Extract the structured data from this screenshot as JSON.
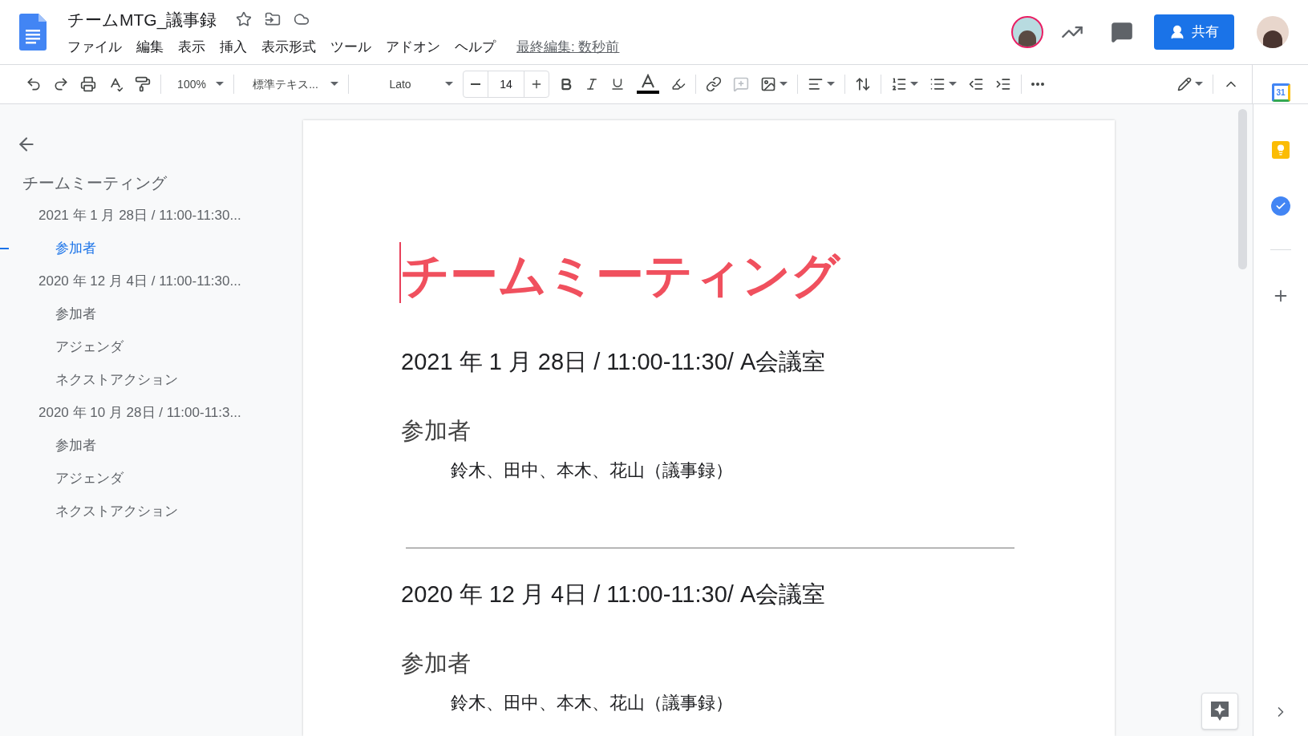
{
  "document": {
    "title": "チームMTG_議事録",
    "last_edit": "最終編集: 数秒前"
  },
  "menus": [
    {
      "label": "ファイル"
    },
    {
      "label": "編集"
    },
    {
      "label": "表示"
    },
    {
      "label": "挿入"
    },
    {
      "label": "表示形式"
    },
    {
      "label": "ツール"
    },
    {
      "label": "アドオン"
    },
    {
      "label": "ヘルプ"
    }
  ],
  "share_button": {
    "label": "共有"
  },
  "toolbar": {
    "zoom": "100%",
    "style": "標準テキス...",
    "font": "Lato",
    "font_size": "14"
  },
  "outline": [
    {
      "label": "チームミーティング",
      "selected": false,
      "children": [
        {
          "label": "2021 年 1 月 28日 / 11:00-11:30...",
          "selected": false,
          "children": [
            {
              "label": "参加者",
              "selected": true
            }
          ]
        },
        {
          "label": "2020 年 12 月 4日 / 11:00-11:30...",
          "selected": false,
          "children": [
            {
              "label": "参加者",
              "selected": false
            },
            {
              "label": "アジェンダ",
              "selected": false
            },
            {
              "label": "ネクストアクション",
              "selected": false
            }
          ]
        },
        {
          "label": "2020 年 10 月 28日 / 11:00-11:3...",
          "selected": false,
          "children": [
            {
              "label": "参加者",
              "selected": false
            },
            {
              "label": "アジェンダ",
              "selected": false
            },
            {
              "label": "ネクストアクション",
              "selected": false
            }
          ]
        }
      ]
    }
  ],
  "page": {
    "title": "チームミーティング",
    "sections": [
      {
        "heading": "2021 年 1 月 28日 / 11:00-11:30/ A会議室",
        "subheading": "参加者",
        "body": "鈴木、田中、本木、花山（議事録）"
      },
      {
        "heading": "2020 年 12 月 4日 / 11:00-11:30/ A会議室",
        "subheading": "参加者",
        "body": "鈴木、田中、本木、花山（議事録）"
      }
    ]
  },
  "side_panel": {
    "calendar_day": "31"
  }
}
